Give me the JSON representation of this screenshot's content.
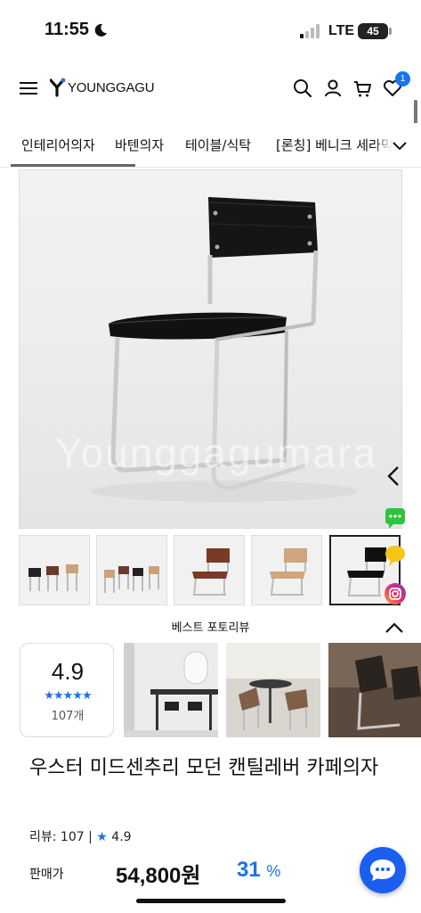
{
  "status_bar": {
    "time": "11:55",
    "network": "LTE",
    "battery": "45"
  },
  "header": {
    "logo_text": "YOUNGGAGU",
    "cart_count": "1"
  },
  "category_tabs": [
    {
      "label": "인테리어의자"
    },
    {
      "label": "바텐의자"
    },
    {
      "label": "테이블/식탁"
    },
    {
      "label": "[론칭] 베니크 세라믹"
    }
  ],
  "gallery": {
    "watermark": "Younggagumara",
    "thumbnail_count": 5,
    "active_thumbnail": 5
  },
  "reviews": {
    "section_title": "베스트 포토리뷰",
    "rating": "4.9",
    "stars": "★★★★★",
    "count": "107개"
  },
  "product": {
    "title": "우스터 미드센추리 모던 캔틸레버 카페의자",
    "review_label": "리뷰: 107 |",
    "review_star": "★",
    "review_rating": "4.9",
    "price_label": "판매가",
    "price": "54,800원",
    "discount": "31",
    "discount_unit": "%"
  },
  "colors": {
    "accent": "#1a73e8",
    "chat_button": "#1a5ff0",
    "talk_icon": "#2ec43d",
    "note_icon": "#f5c518"
  }
}
